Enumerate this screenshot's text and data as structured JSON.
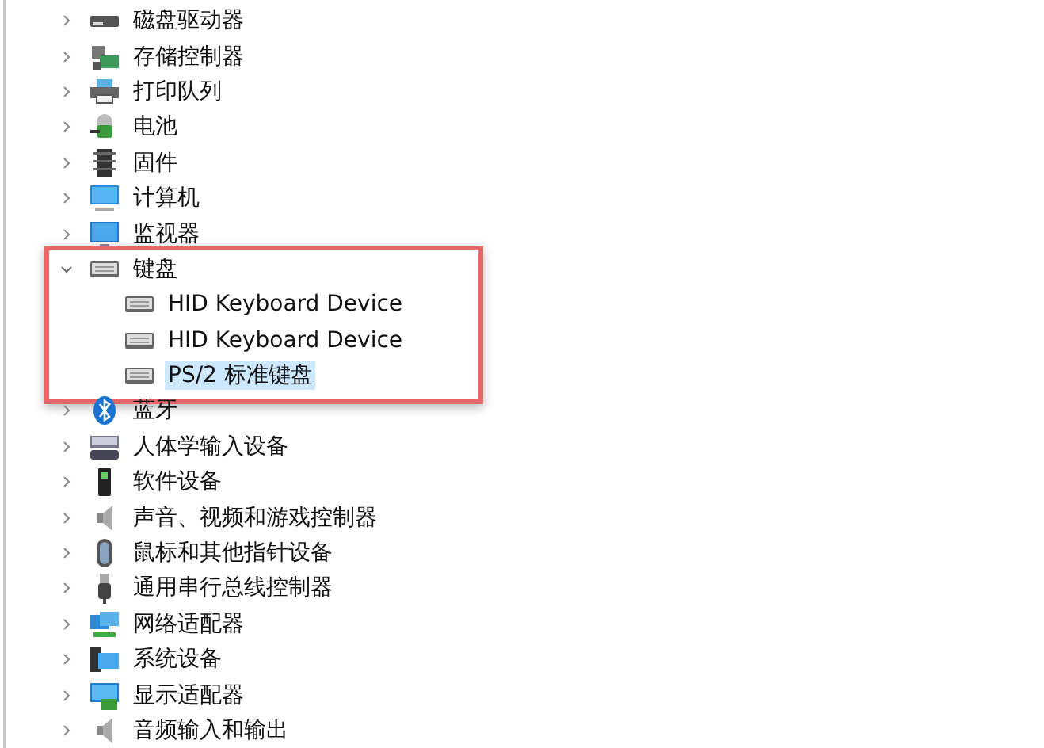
{
  "tree": [
    {
      "label": "磁盘驱动器",
      "kind": "disk",
      "expanded": false,
      "highlighted": false,
      "selected": false
    },
    {
      "label": "存储控制器",
      "kind": "storage",
      "expanded": false,
      "highlighted": false,
      "selected": false
    },
    {
      "label": "打印队列",
      "kind": "printer",
      "expanded": false,
      "highlighted": false,
      "selected": false
    },
    {
      "label": "电池",
      "kind": "battery",
      "expanded": false,
      "highlighted": false,
      "selected": false
    },
    {
      "label": "固件",
      "kind": "chip",
      "expanded": false,
      "highlighted": false,
      "selected": false
    },
    {
      "label": "计算机",
      "kind": "computer",
      "expanded": false,
      "highlighted": false,
      "selected": false
    },
    {
      "label": "监视器",
      "kind": "monitor",
      "expanded": false,
      "highlighted": false,
      "selected": false
    },
    {
      "label": "键盘",
      "kind": "keyboard",
      "expanded": true,
      "highlighted": true,
      "selected": false,
      "children": [
        {
          "label": "HID Keyboard Device",
          "kind": "keyboard",
          "selected": false
        },
        {
          "label": "HID Keyboard Device",
          "kind": "keyboard",
          "selected": false
        },
        {
          "label": "PS/2 标准键盘",
          "kind": "keyboard",
          "selected": true
        }
      ]
    },
    {
      "label": "蓝牙",
      "kind": "bluetooth",
      "expanded": false,
      "highlighted": false,
      "selected": false
    },
    {
      "label": "人体学输入设备",
      "kind": "hid",
      "expanded": false,
      "highlighted": false,
      "selected": false
    },
    {
      "label": "软件设备",
      "kind": "software",
      "expanded": false,
      "highlighted": false,
      "selected": false
    },
    {
      "label": "声音、视频和游戏控制器",
      "kind": "speaker",
      "expanded": false,
      "highlighted": false,
      "selected": false
    },
    {
      "label": "鼠标和其他指针设备",
      "kind": "mouse",
      "expanded": false,
      "highlighted": false,
      "selected": false
    },
    {
      "label": "通用串行总线控制器",
      "kind": "usb",
      "expanded": false,
      "highlighted": false,
      "selected": false
    },
    {
      "label": "网络适配器",
      "kind": "network",
      "expanded": false,
      "highlighted": false,
      "selected": false
    },
    {
      "label": "系统设备",
      "kind": "system",
      "expanded": false,
      "highlighted": false,
      "selected": false
    },
    {
      "label": "显示适配器",
      "kind": "display",
      "expanded": false,
      "highlighted": false,
      "selected": false
    },
    {
      "label": "音频输入和输出",
      "kind": "speaker",
      "expanded": false,
      "highlighted": false,
      "selected": false
    }
  ]
}
